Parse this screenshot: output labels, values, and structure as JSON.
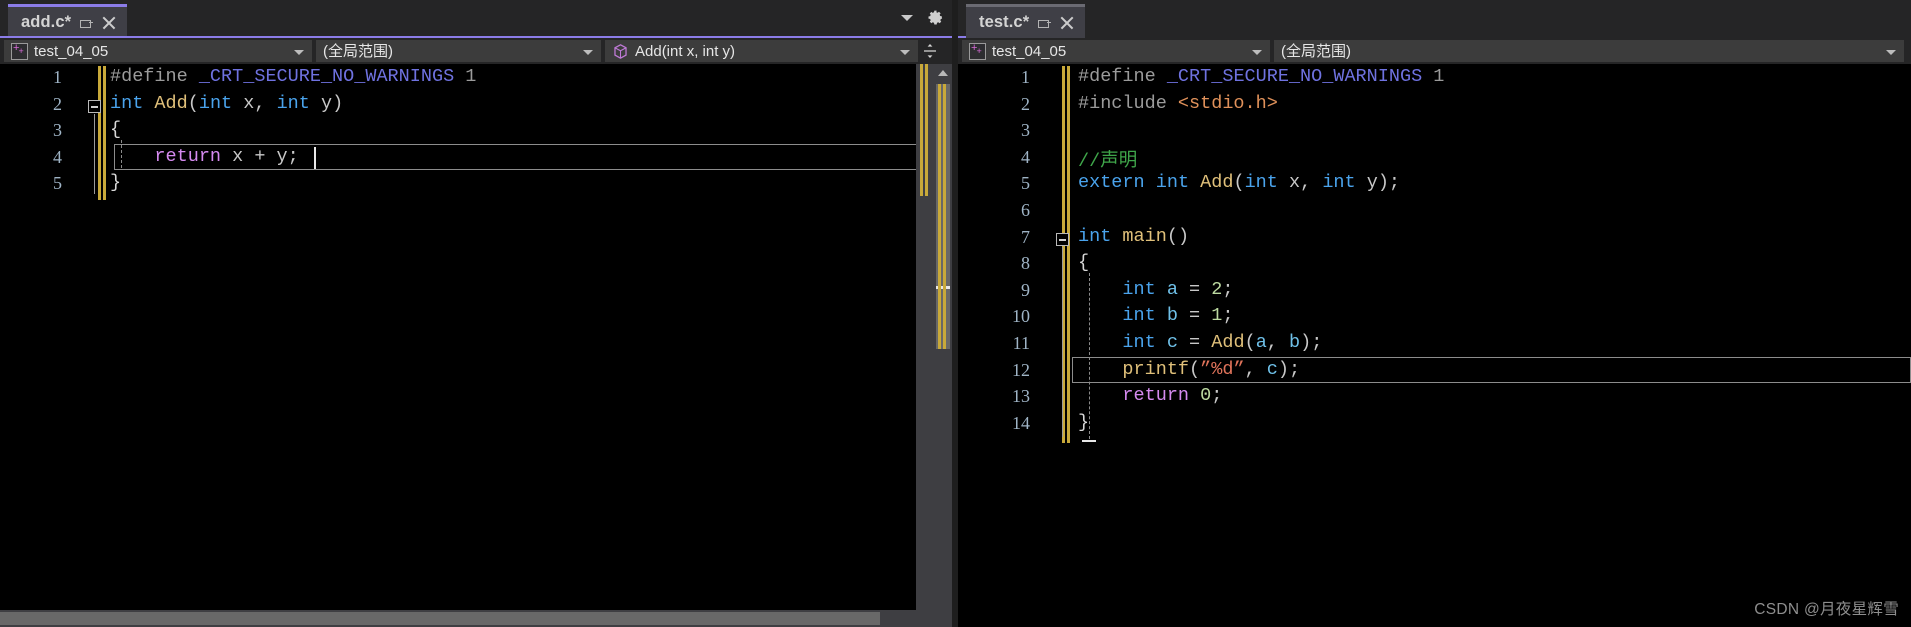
{
  "window": {
    "background": "#1e1e1e",
    "accent_color": "#8b7ce8",
    "editor_background": "#000000"
  },
  "left_pane": {
    "tab": {
      "title": "add.c*",
      "pin_icon": "pin-icon",
      "close_icon": "close-icon"
    },
    "chrome": {
      "dropdown_icon": "chevron-down-icon",
      "settings_icon": "gear-icon"
    },
    "navbar": {
      "project_icon": "cpp-project-icon",
      "project_value": "test_04_05",
      "scope_value": "(全局范围)",
      "member_icon": "method-cube-icon",
      "member_value": "Add(int x, int y)",
      "split_icon": "split-editor-icon"
    },
    "code": {
      "lines": [
        {
          "n": "1",
          "tokens": [
            {
              "t": "#define ",
              "c": "t-pre"
            },
            {
              "t": "_CRT_SECURE_NO_WARNINGS",
              "c": "t-macro"
            },
            {
              "t": " 1",
              "c": "t-pre"
            }
          ]
        },
        {
          "n": "2",
          "tokens": [
            {
              "t": "int",
              "c": "t-key"
            },
            {
              "t": " ",
              "c": "t-op"
            },
            {
              "t": "Add",
              "c": "t-fn"
            },
            {
              "t": "(",
              "c": "t-op"
            },
            {
              "t": "int",
              "c": "t-key"
            },
            {
              "t": " x, ",
              "c": "t-id"
            },
            {
              "t": "int",
              "c": "t-key"
            },
            {
              "t": " y)",
              "c": "t-id"
            }
          ]
        },
        {
          "n": "3",
          "tokens": [
            {
              "t": "{",
              "c": "t-brace"
            }
          ]
        },
        {
          "n": "4",
          "tokens": [
            {
              "t": "    ",
              "c": "t-op"
            },
            {
              "t": "return",
              "c": "t-ret"
            },
            {
              "t": " x + y;",
              "c": "t-id"
            }
          ]
        },
        {
          "n": "5",
          "tokens": [
            {
              "t": "}",
              "c": "t-brace"
            }
          ]
        }
      ]
    }
  },
  "right_pane": {
    "tab": {
      "title": "test.c*",
      "pin_icon": "pin-icon",
      "close_icon": "close-icon"
    },
    "navbar": {
      "project_icon": "cpp-project-icon",
      "project_value": "test_04_05",
      "scope_value": "(全局范围)"
    },
    "code": {
      "lines": [
        {
          "n": "1",
          "tokens": [
            {
              "t": "#define ",
              "c": "t-pre"
            },
            {
              "t": "_CRT_SECURE_NO_WARNINGS",
              "c": "t-macro"
            },
            {
              "t": " 1",
              "c": "t-pre"
            }
          ]
        },
        {
          "n": "2",
          "tokens": [
            {
              "t": "#include ",
              "c": "t-pre"
            },
            {
              "t": "<stdio.h>",
              "c": "t-hdr"
            }
          ]
        },
        {
          "n": "3",
          "tokens": [
            {
              "t": "",
              "c": "t-op"
            }
          ]
        },
        {
          "n": "4",
          "tokens": [
            {
              "t": "//声明",
              "c": "t-cmt"
            }
          ]
        },
        {
          "n": "5",
          "tokens": [
            {
              "t": "extern",
              "c": "t-key"
            },
            {
              "t": " ",
              "c": "t-op"
            },
            {
              "t": "int",
              "c": "t-key"
            },
            {
              "t": " ",
              "c": "t-op"
            },
            {
              "t": "Add",
              "c": "t-fn"
            },
            {
              "t": "(",
              "c": "t-op"
            },
            {
              "t": "int",
              "c": "t-key"
            },
            {
              "t": " x, ",
              "c": "t-id"
            },
            {
              "t": "int",
              "c": "t-key"
            },
            {
              "t": " y);",
              "c": "t-id"
            }
          ]
        },
        {
          "n": "6",
          "tokens": [
            {
              "t": "",
              "c": "t-op"
            }
          ]
        },
        {
          "n": "7",
          "tokens": [
            {
              "t": "int",
              "c": "t-key"
            },
            {
              "t": " ",
              "c": "t-op"
            },
            {
              "t": "main",
              "c": "t-fn"
            },
            {
              "t": "()",
              "c": "t-id"
            }
          ]
        },
        {
          "n": "8",
          "tokens": [
            {
              "t": "{",
              "c": "t-brace"
            }
          ]
        },
        {
          "n": "9",
          "tokens": [
            {
              "t": "    ",
              "c": "t-op"
            },
            {
              "t": "int",
              "c": "t-key"
            },
            {
              "t": " ",
              "c": "t-op"
            },
            {
              "t": "a",
              "c": "t-var"
            },
            {
              "t": " = ",
              "c": "t-op"
            },
            {
              "t": "2",
              "c": "t-num"
            },
            {
              "t": ";",
              "c": "t-op"
            }
          ]
        },
        {
          "n": "10",
          "tokens": [
            {
              "t": "    ",
              "c": "t-op"
            },
            {
              "t": "int",
              "c": "t-key"
            },
            {
              "t": " ",
              "c": "t-op"
            },
            {
              "t": "b",
              "c": "t-var"
            },
            {
              "t": " = ",
              "c": "t-op"
            },
            {
              "t": "1",
              "c": "t-num"
            },
            {
              "t": ";",
              "c": "t-op"
            }
          ]
        },
        {
          "n": "11",
          "tokens": [
            {
              "t": "    ",
              "c": "t-op"
            },
            {
              "t": "int",
              "c": "t-key"
            },
            {
              "t": " ",
              "c": "t-op"
            },
            {
              "t": "c",
              "c": "t-var"
            },
            {
              "t": " = ",
              "c": "t-op"
            },
            {
              "t": "Add",
              "c": "t-fn"
            },
            {
              "t": "(",
              "c": "t-op"
            },
            {
              "t": "a",
              "c": "t-var"
            },
            {
              "t": ", ",
              "c": "t-op"
            },
            {
              "t": "b",
              "c": "t-var"
            },
            {
              "t": ");",
              "c": "t-op"
            }
          ]
        },
        {
          "n": "12",
          "tokens": [
            {
              "t": "    ",
              "c": "t-op"
            },
            {
              "t": "printf",
              "c": "t-fn"
            },
            {
              "t": "(",
              "c": "t-op"
            },
            {
              "t": "”%d”",
              "c": "t-str"
            },
            {
              "t": ", ",
              "c": "t-op"
            },
            {
              "t": "c",
              "c": "t-var"
            },
            {
              "t": ");",
              "c": "t-op"
            }
          ]
        },
        {
          "n": "13",
          "tokens": [
            {
              "t": "    ",
              "c": "t-op"
            },
            {
              "t": "return",
              "c": "t-ret"
            },
            {
              "t": " ",
              "c": "t-op"
            },
            {
              "t": "0",
              "c": "t-num"
            },
            {
              "t": ";",
              "c": "t-op"
            }
          ]
        },
        {
          "n": "14",
          "tokens": [
            {
              "t": "}",
              "c": "t-brace"
            }
          ]
        }
      ]
    }
  },
  "watermark": "CSDN @月夜星辉雪"
}
